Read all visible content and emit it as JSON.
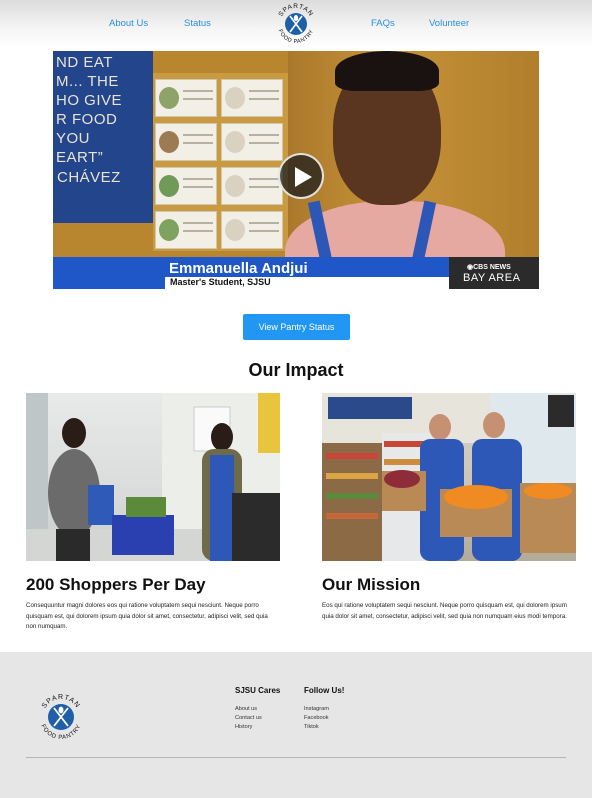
{
  "nav": {
    "about": "About Us",
    "status": "Status",
    "faqs": "FAQs",
    "volunteer": "Volunteer"
  },
  "logo": {
    "top_text": "SPARTAN",
    "bottom_text": "FOOD PANTRY"
  },
  "video": {
    "quote_text": "ND EAT\nM... THE\nHO GIVE\nR FOOD\nYOU\nEART”",
    "quote_author": "CHÁVEZ",
    "caption_name": "Emmanuella Andjui",
    "caption_subtitle": "Master's Student, SJSU",
    "network_top": "◉CBS NEWS",
    "network_bottom": "BAY AREA",
    "play_icon": "play-icon"
  },
  "cta": {
    "label": "View Pantry Status"
  },
  "impact": {
    "title": "Our Impact",
    "cards": [
      {
        "title": "200 Shoppers Per Day",
        "text": "Consequuntur magni dolores eos qui ratione voluptatem sequi nesciunt. Neque porro quisquam est, qui dolorem ipsum quia dolor sit amet, consectetur, adipisci velit, sed quia non numquam."
      },
      {
        "title": "Our Mission",
        "text": "Eos qui ratione voluptatem sequi nesciunt. Neque porro quisquam est, qui dolorem ipsum quia dolor sit amet, consectetur, adipisci velit, sed quia non numquam eius modi tempora."
      }
    ]
  },
  "footer": {
    "cares_heading": "SJSU Cares",
    "cares_links": [
      "About us",
      "Contact us",
      "History"
    ],
    "follow_heading": "Follow Us!",
    "follow_links": [
      "Instagram",
      "Facebook",
      "Tiktok"
    ]
  },
  "colors": {
    "accent": "#2196f3",
    "nav_link": "#2a8fe0",
    "logo_blue": "#1f5fa8",
    "footer_bg": "#e6e6e6"
  }
}
